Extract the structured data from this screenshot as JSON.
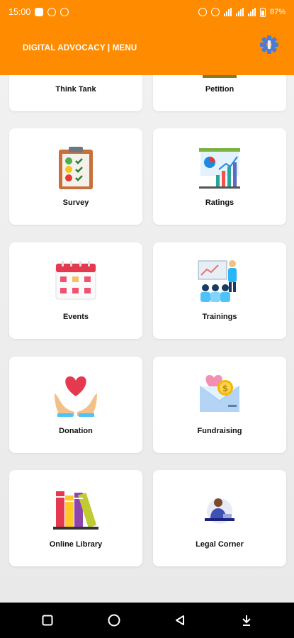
{
  "status_bar": {
    "time": "15:00",
    "battery": "87%",
    "network_tags": [
      "4G",
      "4G"
    ]
  },
  "header": {
    "title": "DIGITAL ADVOCACY | MENU",
    "settings_icon": "gear-icon",
    "accent_color": "#ff8c00"
  },
  "menu": {
    "items": [
      {
        "label": "Think Tank",
        "icon": "think-tank-icon"
      },
      {
        "label": "Petition",
        "icon": "petition-icon"
      },
      {
        "label": "Survey",
        "icon": "survey-clipboard-icon"
      },
      {
        "label": "Ratings",
        "icon": "ratings-chart-icon"
      },
      {
        "label": "Events",
        "icon": "events-calendar-icon"
      },
      {
        "label": "Trainings",
        "icon": "trainings-presentation-icon"
      },
      {
        "label": "Donation",
        "icon": "donation-heart-hands-icon"
      },
      {
        "label": "Fundraising",
        "icon": "fundraising-envelope-icon"
      },
      {
        "label": "Online Library",
        "icon": "online-library-books-icon"
      },
      {
        "label": "Legal Corner",
        "icon": "legal-corner-lawyer-icon"
      }
    ]
  },
  "nav": {
    "buttons": [
      "recents-square-icon",
      "home-circle-icon",
      "back-triangle-icon",
      "notification-pull-down-icon"
    ]
  }
}
